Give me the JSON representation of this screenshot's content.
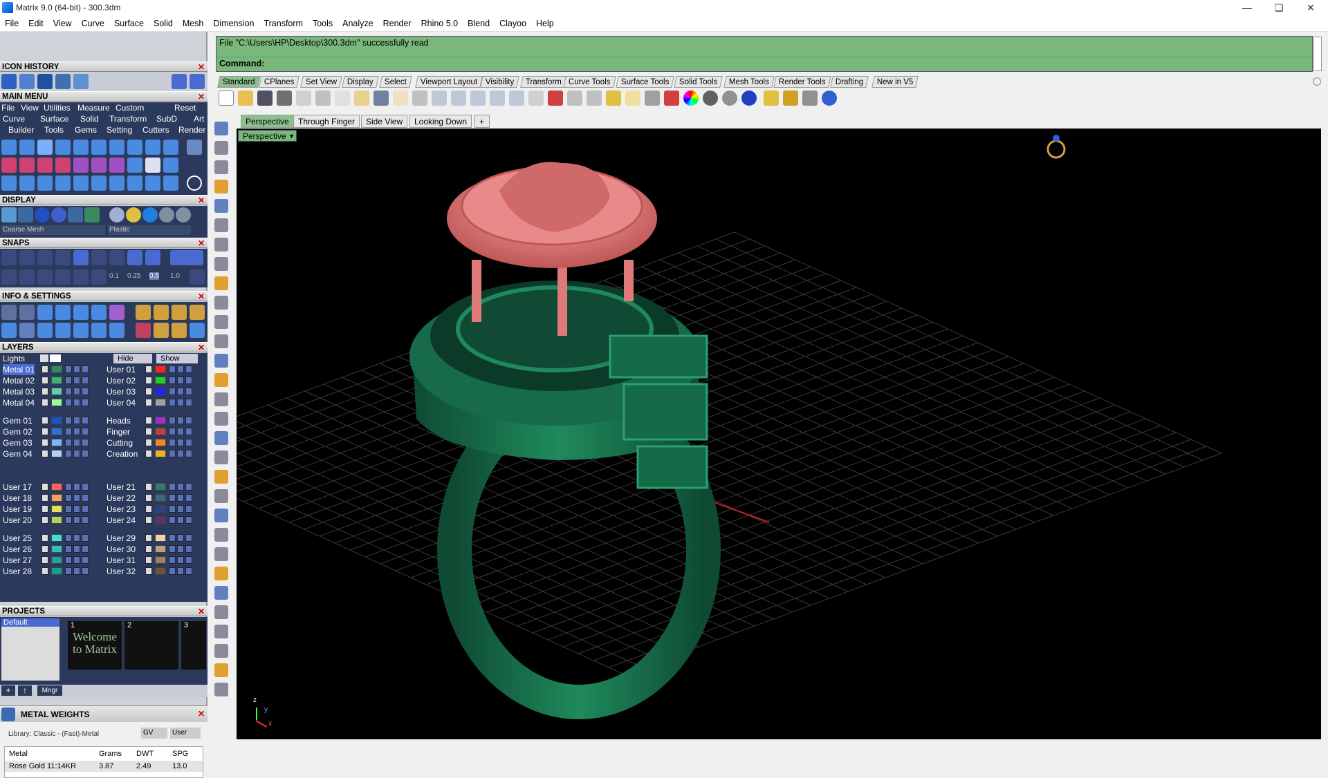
{
  "window": {
    "title": "Matrix 9.0 (64-bit) - 300.3dm"
  },
  "menu": [
    "File",
    "Edit",
    "View",
    "Curve",
    "Surface",
    "Solid",
    "Mesh",
    "Dimension",
    "Transform",
    "Tools",
    "Analyze",
    "Render",
    "Rhino 5.0",
    "Blend",
    "Clayoo",
    "Help"
  ],
  "panels": {
    "icon_history": "ICON HISTORY",
    "main_menu": "MAIN MENU",
    "main_menu_items": [
      "File",
      "View",
      "Utilities",
      "Measure",
      "Custom",
      "Reset"
    ],
    "main_menu_row2": [
      "Curve",
      "Surface",
      "Solid",
      "Transform",
      "SubD",
      "Art"
    ],
    "main_menu_row3": [
      "Builder",
      "Tools",
      "Gems",
      "Setting",
      "Cutters",
      "Render"
    ],
    "display": "DISPLAY",
    "display_mesh": "Coarse Mesh",
    "display_material": "Plastic",
    "snaps": "SNAPS",
    "snap_values": [
      "0.1",
      "0.25",
      "0.5",
      "1.0"
    ],
    "info_settings": "INFO & SETTINGS",
    "layers": "LAYERS",
    "projects": "PROJECTS",
    "metal_weights": "METAL WEIGHTS"
  },
  "layers": {
    "lights": "Lights",
    "hide": "Hide",
    "show": "Show",
    "left": [
      {
        "name": "Metal 01",
        "color": "#2e8b57",
        "selected": true
      },
      {
        "name": "Metal 02",
        "color": "#3cb371"
      },
      {
        "name": "Metal 03",
        "color": "#66cdaa"
      },
      {
        "name": "Metal 04",
        "color": "#98fb98"
      },
      {
        "name": "Gem 01",
        "color": "#1e50c8"
      },
      {
        "name": "Gem 02",
        "color": "#2f6fd8"
      },
      {
        "name": "Gem 03",
        "color": "#7fb2ff"
      },
      {
        "name": "Gem 04",
        "color": "#b0d0ff"
      }
    ],
    "right": [
      {
        "name": "User 01",
        "color": "#ff2020"
      },
      {
        "name": "User 02",
        "color": "#20d020"
      },
      {
        "name": "User 03",
        "color": "#2020ff"
      },
      {
        "name": "User 04",
        "color": "#a0a0a0"
      },
      {
        "name": "Heads",
        "color": "#a030d0"
      },
      {
        "name": "Finger",
        "color": "#c04040"
      },
      {
        "name": "Cutting",
        "color": "#ff8020"
      },
      {
        "name": "Creation",
        "color": "#f0b020"
      }
    ],
    "left2": [
      {
        "name": "User 17",
        "color": "#ff6060"
      },
      {
        "name": "User 18",
        "color": "#f0a060"
      },
      {
        "name": "User 19",
        "color": "#e0e060"
      },
      {
        "name": "User 20",
        "color": "#b0d060"
      },
      {
        "name": "User 25",
        "color": "#40e0d0"
      },
      {
        "name": "User 26",
        "color": "#30c0c0"
      },
      {
        "name": "User 27",
        "color": "#20a0a0"
      },
      {
        "name": "User 28",
        "color": "#10a090"
      }
    ],
    "right2": [
      {
        "name": "User 21",
        "color": "#2e7d6e"
      },
      {
        "name": "User 22",
        "color": "#3a6a7a"
      },
      {
        "name": "User 23",
        "color": "#304080"
      },
      {
        "name": "User 24",
        "color": "#603070"
      },
      {
        "name": "User 29",
        "color": "#f0d0b0"
      },
      {
        "name": "User 30",
        "color": "#c0a080"
      },
      {
        "name": "User 31",
        "color": "#a08060"
      },
      {
        "name": "User 32",
        "color": "#705040"
      }
    ]
  },
  "projects": {
    "default": "Default",
    "thumbs": [
      "1",
      "2",
      "3"
    ],
    "welcome": "Welcome to Matrix",
    "mngr": "Mngr"
  },
  "metal": {
    "library": "Library: Classic - (Fast)-Metal",
    "gv": "GV",
    "user": "User",
    "headers": [
      "Metal",
      "Grams",
      "DWT",
      "SPG"
    ],
    "row": [
      "Rose Gold 11:14KR",
      "3.87",
      "2.49",
      "13.0"
    ]
  },
  "command": {
    "line1": "File \"C:\\Users\\HP\\Desktop\\300.3dm\" successfully read",
    "prompt": "Command:"
  },
  "toolbar_tabs": [
    "Standard",
    "CPlanes",
    "Set View",
    "Display",
    "Select",
    "Viewport Layout",
    "Visibility",
    "Transform",
    "Curve Tools",
    "Surface Tools",
    "Solid Tools",
    "Mesh Tools",
    "Render Tools",
    "Drafting",
    "New in V5"
  ],
  "viewport_tabs": [
    "Perspective",
    "Through Finger",
    "Side View",
    "Looking Down"
  ],
  "viewport": {
    "label": "Perspective",
    "axis_z": "z",
    "axis_y": "y",
    "axis_x": "x"
  },
  "colors": {
    "accent": "#7ab77a",
    "ring": "#1e7a55",
    "top": "#e07a7a"
  }
}
